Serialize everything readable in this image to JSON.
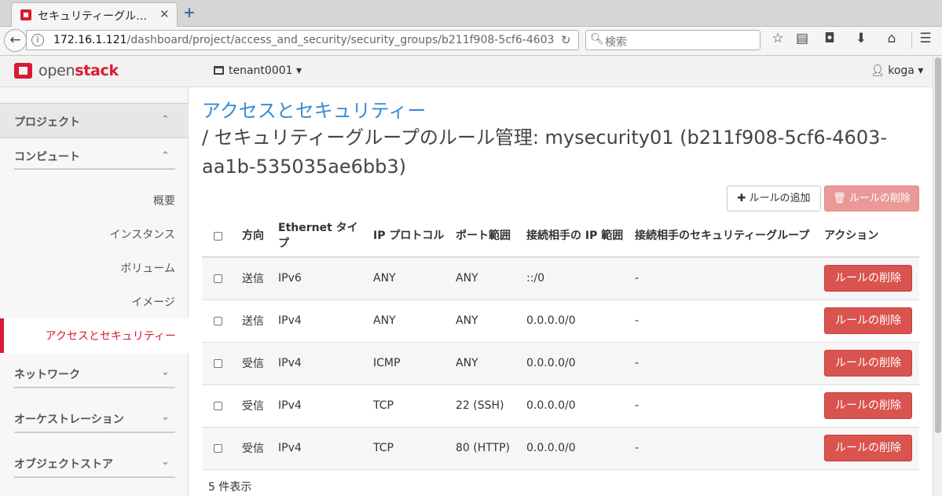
{
  "browser": {
    "tab_title": "セキュリティーグル…",
    "url_host": "172.16.1.121",
    "url_path": "/dashboard/project/access_and_security/security_groups/b211f908-5cf6-4603",
    "search_placeholder": "検索"
  },
  "header": {
    "logo_open": "open",
    "logo_stack": "stack",
    "tenant": "tenant0001",
    "user": "koga"
  },
  "sidebar": {
    "project": "プロジェクト",
    "compute": "コンピュート",
    "items": [
      "概要",
      "インスタンス",
      "ボリューム",
      "イメージ"
    ],
    "active": "アクセスとセキュリティー",
    "groups": [
      "ネットワーク",
      "オーケストレーション",
      "オブジェクトストア"
    ]
  },
  "main": {
    "title": "アクセスとセキュリティー",
    "subtitle": "/ セキュリティーグループのルール管理: mysecurity01 (b211f908-5cf6-4603-aa1b-535035ae6bb3)",
    "add_rule": "ルールの追加",
    "delete_rules": "ルールの削除",
    "columns": [
      "方向",
      "Ethernet タイプ",
      "IP プロトコル",
      "ポート範囲",
      "接続相手の IP 範囲",
      "接続相手のセキュリティーグループ",
      "アクション"
    ],
    "rows": [
      {
        "direction": "送信",
        "ether": "IPv6",
        "proto": "ANY",
        "port": "ANY",
        "ip_range": "::/0",
        "group": "-",
        "action": "ルールの削除"
      },
      {
        "direction": "送信",
        "ether": "IPv4",
        "proto": "ANY",
        "port": "ANY",
        "ip_range": "0.0.0.0/0",
        "group": "-",
        "action": "ルールの削除"
      },
      {
        "direction": "受信",
        "ether": "IPv4",
        "proto": "ICMP",
        "port": "ANY",
        "ip_range": "0.0.0.0/0",
        "group": "-",
        "action": "ルールの削除"
      },
      {
        "direction": "受信",
        "ether": "IPv4",
        "proto": "TCP",
        "port": "22 (SSH)",
        "ip_range": "0.0.0.0/0",
        "group": "-",
        "action": "ルールの削除"
      },
      {
        "direction": "受信",
        "ether": "IPv4",
        "proto": "TCP",
        "port": "80 (HTTP)",
        "ip_range": "0.0.0.0/0",
        "group": "-",
        "action": "ルールの削除"
      }
    ],
    "footer": "5 件表示"
  },
  "colors": {
    "brand": "#da1a32",
    "link": "#3a8ad6",
    "danger": "#d9534f"
  }
}
